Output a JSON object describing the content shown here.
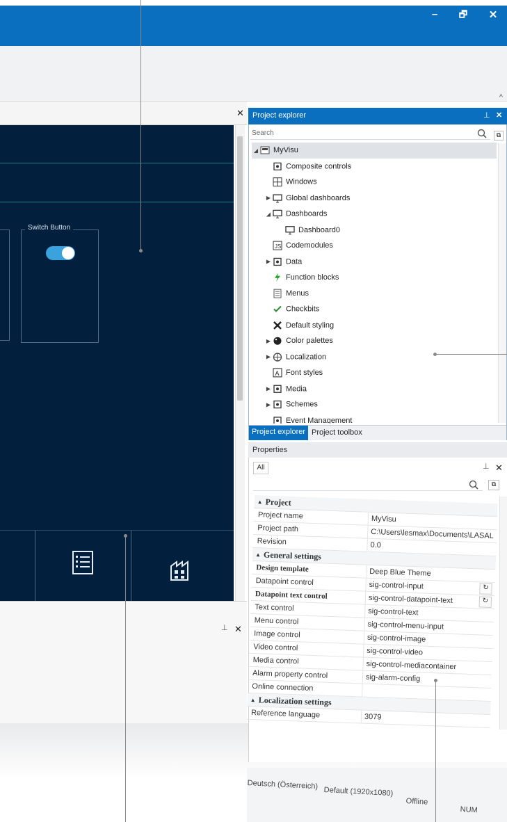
{
  "window": {
    "minimize_icon": "–",
    "restore_icon": "🗗",
    "close_icon": "✕",
    "ribbon_collapse_icon": "^"
  },
  "designer": {
    "close_icon": "✕",
    "switch_button_label": "Switch Button",
    "switch_value": "on"
  },
  "bottom_panel": {
    "pin_icon": "📌",
    "close_icon": "✕"
  },
  "project_explorer": {
    "title": "Project explorer",
    "search_placeholder": "Search",
    "tabs": [
      "Project explorer",
      "Project toolbox"
    ],
    "tree": [
      {
        "label": "MyVisu",
        "depth": 0,
        "arrow": "down",
        "icon": "visu-icon"
      },
      {
        "label": "Composite controls",
        "depth": 1,
        "arrow": "",
        "icon": "composite-icon"
      },
      {
        "label": "Windows",
        "depth": 1,
        "arrow": "",
        "icon": "windows-icon"
      },
      {
        "label": "Global dashboards",
        "depth": 1,
        "arrow": "right",
        "icon": "global-dashboard-icon"
      },
      {
        "label": "Dashboards",
        "depth": 1,
        "arrow": "down",
        "icon": "dashboard-icon"
      },
      {
        "label": "Dashboard0",
        "depth": 2,
        "arrow": "",
        "icon": "dashboard-icon"
      },
      {
        "label": "Codemodules",
        "depth": 1,
        "arrow": "",
        "icon": "js-icon"
      },
      {
        "label": "Data",
        "depth": 1,
        "arrow": "right",
        "icon": "data-icon"
      },
      {
        "label": "Function blocks",
        "depth": 1,
        "arrow": "",
        "icon": "lightning-icon"
      },
      {
        "label": "Menus",
        "depth": 1,
        "arrow": "",
        "icon": "menu-icon"
      },
      {
        "label": "Checkbits",
        "depth": 1,
        "arrow": "",
        "icon": "checkbits-icon"
      },
      {
        "label": "Default styling",
        "depth": 1,
        "arrow": "",
        "icon": "tools-icon"
      },
      {
        "label": "Color palettes",
        "depth": 1,
        "arrow": "right",
        "icon": "palette-icon"
      },
      {
        "label": "Localization",
        "depth": 1,
        "arrow": "right",
        "icon": "globe-icon"
      },
      {
        "label": "Font styles",
        "depth": 1,
        "arrow": "",
        "icon": "font-icon"
      },
      {
        "label": "Media",
        "depth": 1,
        "arrow": "right",
        "icon": "media-icon"
      },
      {
        "label": "Schemes",
        "depth": 1,
        "arrow": "right",
        "icon": "schemes-icon"
      },
      {
        "label": "Event Management",
        "depth": 1,
        "arrow": "",
        "icon": "event-icon"
      }
    ]
  },
  "properties": {
    "title": "Properties",
    "filter_label": "All",
    "rows": [
      {
        "type": "category",
        "name": "Project"
      },
      {
        "type": "prop",
        "name": "Project name",
        "value": "MyVisu"
      },
      {
        "type": "prop",
        "name": "Project path",
        "value": "C:\\Users\\lesmax\\Documents\\LASAL"
      },
      {
        "type": "prop",
        "name": "Revision",
        "value": "0.0"
      },
      {
        "type": "category",
        "name": "General settings"
      },
      {
        "type": "bold",
        "name": "Design template",
        "value": "Deep Blue Theme"
      },
      {
        "type": "prop",
        "name": "Datapoint control",
        "value": "sig-control-input",
        "reset": "↻"
      },
      {
        "type": "bold",
        "name": "Datapoint text control",
        "value": "sig-control-datapoint-text",
        "reset": "↻"
      },
      {
        "type": "prop",
        "name": "Text control",
        "value": "sig-control-text"
      },
      {
        "type": "prop",
        "name": "Menu control",
        "value": "sig-control-menu-input"
      },
      {
        "type": "prop",
        "name": "Image control",
        "value": "sig-control-image"
      },
      {
        "type": "prop",
        "name": "Video control",
        "value": "sig-control-video"
      },
      {
        "type": "prop",
        "name": "Media control",
        "value": "sig-control-mediacontainer"
      },
      {
        "type": "prop",
        "name": "Alarm property control",
        "value": "sig-alarm-config"
      },
      {
        "type": "prop",
        "name": "Online connection",
        "value": ""
      },
      {
        "type": "category",
        "name": "Localization settings"
      },
      {
        "type": "prop",
        "name": "Reference language",
        "value": "3079"
      }
    ]
  },
  "status_bar": {
    "language": "Deutsch (Österreich)",
    "resolution": "Default (1920x1080)",
    "connection": "Offline",
    "num": "NUM"
  },
  "colors": {
    "accent": "#0a6fbf",
    "canvas": "#02203d",
    "toggle": "#3aa3dd"
  }
}
